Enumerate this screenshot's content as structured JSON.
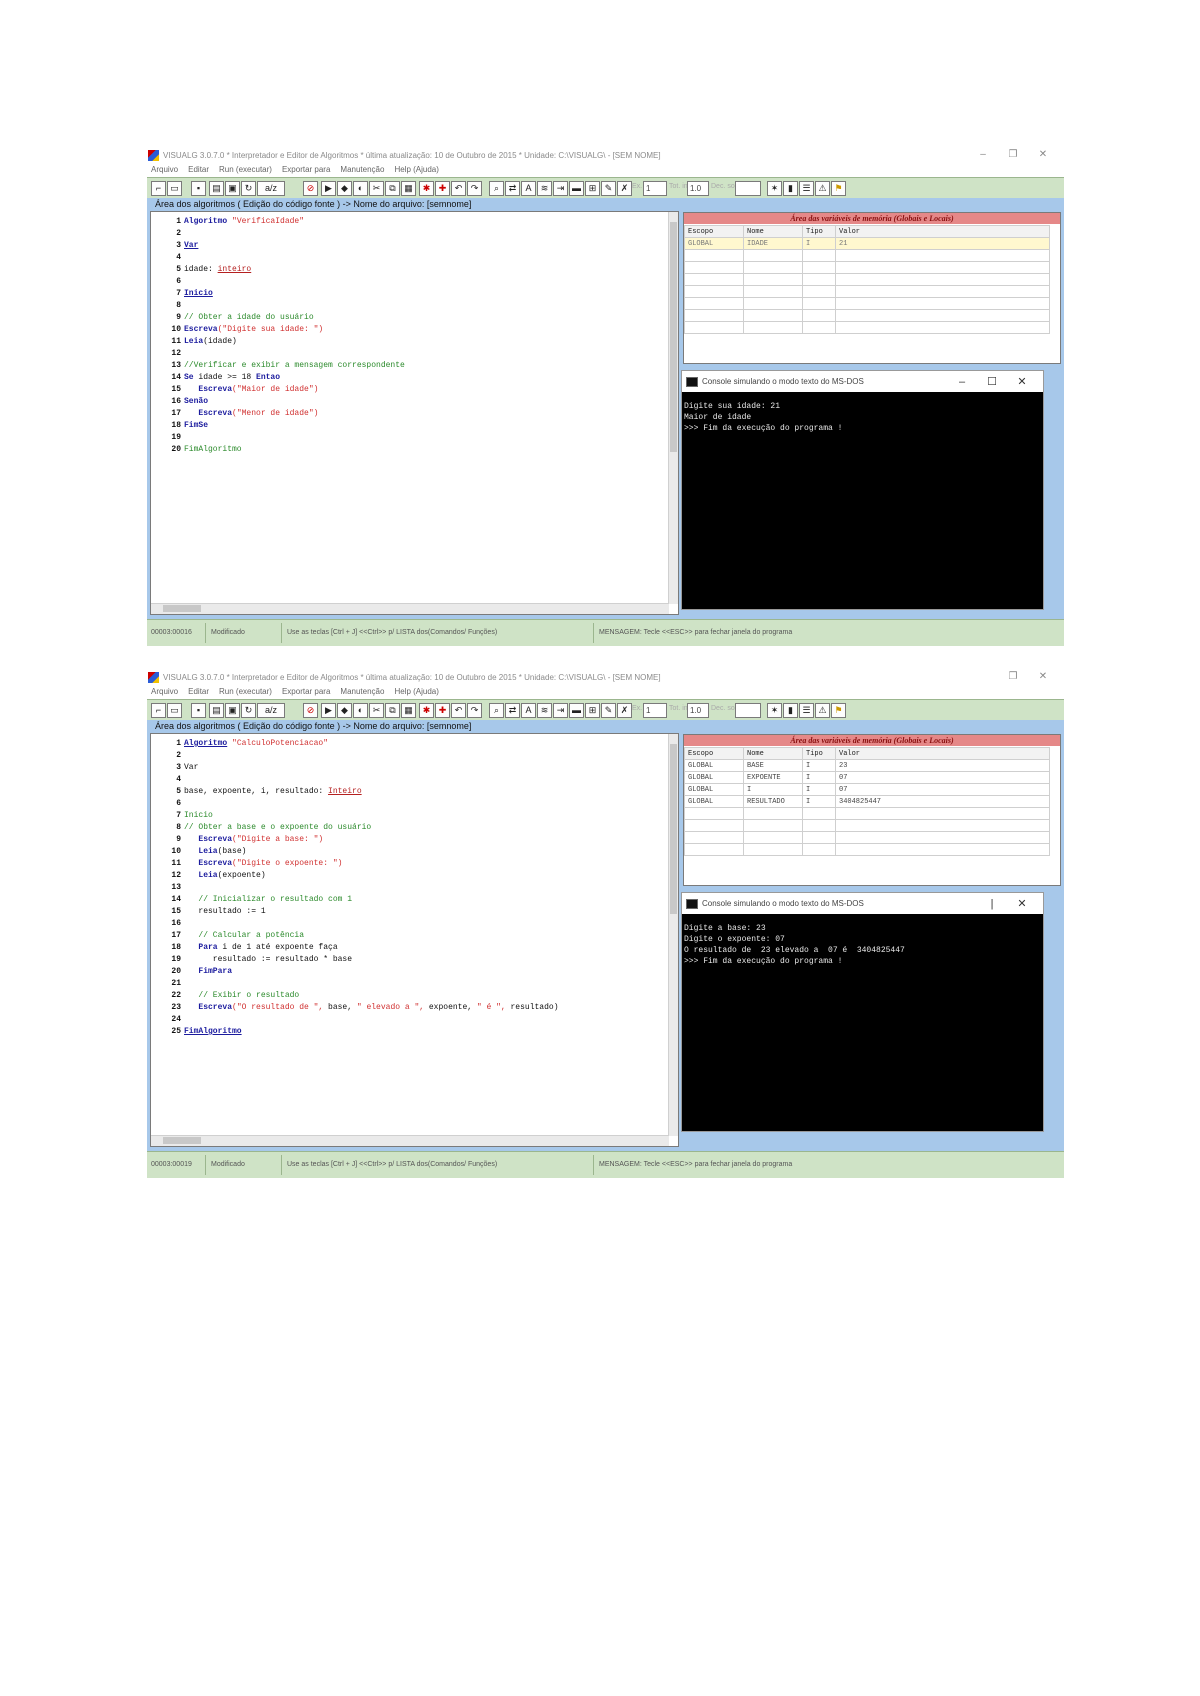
{
  "shot1": {
    "title": "VISUALG 3.0.7.0 * Interpretador e Editor de Algoritmos * última atualização: 10 de Outubro de 2015 * Unidade: C:\\VISUALG\\ - [SEM NOME]",
    "window_buttons": [
      "–",
      "❐",
      "✕"
    ],
    "menu": [
      "Arquivo",
      "Editar",
      "Run (executar)",
      "Exportar para",
      "Manutenção",
      "Help (Ajuda)"
    ],
    "toolbar_inputs": [
      "1",
      "1.0",
      ""
    ],
    "toolbar_labels": [
      "Ex.",
      "Tot. ini",
      "Dec. sor"
    ],
    "area_title": "Área dos algoritmos ( Edição do código fonte ) -> Nome do arquivo: [semnome]",
    "code": [
      {
        "n": "1",
        "segs": [
          {
            "c": "kw",
            "t": "Algoritmo "
          },
          {
            "c": "str",
            "t": "\"VerificaIdade\""
          }
        ]
      },
      {
        "n": "2",
        "segs": []
      },
      {
        "n": "3",
        "segs": [
          {
            "c": "kwu",
            "t": "Var"
          }
        ]
      },
      {
        "n": "4",
        "segs": []
      },
      {
        "n": "5",
        "segs": [
          {
            "c": "var",
            "t": "idade: "
          },
          {
            "c": "type",
            "t": "inteiro"
          }
        ]
      },
      {
        "n": "6",
        "segs": []
      },
      {
        "n": "7",
        "segs": [
          {
            "c": "kwu",
            "t": "Inicio"
          }
        ]
      },
      {
        "n": "8",
        "segs": []
      },
      {
        "n": "9",
        "segs": [
          {
            "c": "com",
            "t": "// Obter a idade do usuário"
          }
        ]
      },
      {
        "n": "10",
        "segs": [
          {
            "c": "kw",
            "t": "Escreva"
          },
          {
            "c": "str",
            "t": "(\"Digite sua idade: \")"
          }
        ]
      },
      {
        "n": "11",
        "segs": [
          {
            "c": "kw",
            "t": "Leia"
          },
          {
            "c": "var",
            "t": "(idade)"
          }
        ]
      },
      {
        "n": "12",
        "segs": []
      },
      {
        "n": "13",
        "segs": [
          {
            "c": "com",
            "t": "//Verificar e exibir a mensagem correspondente"
          }
        ]
      },
      {
        "n": "14",
        "segs": [
          {
            "c": "kw",
            "t": "Se "
          },
          {
            "c": "var",
            "t": "idade >= 18 "
          },
          {
            "c": "kw",
            "t": "Entao"
          }
        ]
      },
      {
        "n": "15",
        "segs": [
          {
            "c": "kw",
            "t": "   Escreva"
          },
          {
            "c": "str",
            "t": "(\"Maior de idade\")"
          }
        ]
      },
      {
        "n": "16",
        "segs": [
          {
            "c": "kw",
            "t": "Senão"
          }
        ]
      },
      {
        "n": "17",
        "segs": [
          {
            "c": "kw",
            "t": "   Escreva"
          },
          {
            "c": "str",
            "t": "(\"Menor de idade\")"
          }
        ]
      },
      {
        "n": "18",
        "segs": [
          {
            "c": "kw",
            "t": "FimSe"
          }
        ]
      },
      {
        "n": "19",
        "segs": []
      },
      {
        "n": "20",
        "segs": [
          {
            "c": "com",
            "t": "FimAlgoritmo"
          }
        ]
      }
    ],
    "vars_title": "Área das variáveis de memória (Globais e Locais)",
    "vars_headers": [
      "Escopo",
      "Nome",
      "Tipo",
      "Valor"
    ],
    "vars_rows": [
      [
        "GLOBAL",
        "IDADE",
        "I",
        "21"
      ]
    ],
    "console_title": "Console simulando o modo texto do MS-DOS",
    "console_buttons": [
      "–",
      "☐",
      "✕"
    ],
    "console_lines": [
      "Digite sua idade: 21",
      "Maior de idade",
      ">>> Fim da execução do programa !"
    ],
    "status": [
      "00003:00016",
      "Modificado",
      "Use as teclas [Ctrl + J] <<Ctrl>> p/ LISTA dos(Comandos/ Funções)",
      "MENSAGEM: Tecle <<ESC>> para fechar janela do programa"
    ]
  },
  "shot2": {
    "title": "VISUALG 3.0.7.0 * Interpretador e Editor de Algoritmos * última atualização: 10 de Outubro de 2015 * Unidade: C:\\VISUALG\\ - [SEM NOME]",
    "window_buttons": [
      "❐",
      "✕"
    ],
    "menu": [
      "Arquivo",
      "Editar",
      "Run (executar)",
      "Exportar para",
      "Manutenção",
      "Help (Ajuda)"
    ],
    "toolbar_inputs": [
      "1",
      "1.0",
      ""
    ],
    "toolbar_labels": [
      "Ex.",
      "Tot. ini",
      "Dec. sor"
    ],
    "area_title": "Área dos algoritmos ( Edição do código fonte ) -> Nome do arquivo: [semnome]",
    "code": [
      {
        "n": "1",
        "segs": [
          {
            "c": "kwu",
            "t": "Algoritmo"
          },
          {
            "c": "str",
            "t": " \"CalculoPotenciacao\""
          }
        ]
      },
      {
        "n": "2",
        "segs": []
      },
      {
        "n": "3",
        "segs": [
          {
            "c": "var",
            "t": "Var"
          }
        ]
      },
      {
        "n": "4",
        "segs": []
      },
      {
        "n": "5",
        "segs": [
          {
            "c": "var",
            "t": "base, expoente, i, resultado: "
          },
          {
            "c": "type",
            "t": "Inteiro"
          }
        ]
      },
      {
        "n": "6",
        "segs": []
      },
      {
        "n": "7",
        "segs": [
          {
            "c": "com",
            "t": "Inicio"
          }
        ]
      },
      {
        "n": "8",
        "segs": [
          {
            "c": "com",
            "t": "// Obter a base e o expoente do usuário"
          }
        ]
      },
      {
        "n": "9",
        "segs": [
          {
            "c": "kw",
            "t": "   Escreva"
          },
          {
            "c": "str",
            "t": "(\"Digite a base: \")"
          }
        ]
      },
      {
        "n": "10",
        "segs": [
          {
            "c": "kw",
            "t": "   Leia"
          },
          {
            "c": "var",
            "t": "(base)"
          }
        ]
      },
      {
        "n": "11",
        "segs": [
          {
            "c": "kw",
            "t": "   Escreva"
          },
          {
            "c": "str",
            "t": "(\"Digite o expoente: \")"
          }
        ]
      },
      {
        "n": "12",
        "segs": [
          {
            "c": "kw",
            "t": "   Leia"
          },
          {
            "c": "var",
            "t": "(expoente)"
          }
        ]
      },
      {
        "n": "13",
        "segs": []
      },
      {
        "n": "14",
        "segs": [
          {
            "c": "com",
            "t": "   // Inicializar o resultado com 1"
          }
        ]
      },
      {
        "n": "15",
        "segs": [
          {
            "c": "var",
            "t": "   resultado := 1"
          }
        ]
      },
      {
        "n": "16",
        "segs": []
      },
      {
        "n": "17",
        "segs": [
          {
            "c": "com",
            "t": "   // Calcular a potência"
          }
        ]
      },
      {
        "n": "18",
        "segs": [
          {
            "c": "kw",
            "t": "   Para "
          },
          {
            "c": "var",
            "t": "i de 1 até expoente faça"
          }
        ]
      },
      {
        "n": "19",
        "segs": [
          {
            "c": "var",
            "t": "      resultado := resultado * base"
          }
        ]
      },
      {
        "n": "20",
        "segs": [
          {
            "c": "kw",
            "t": "   FimPara"
          }
        ]
      },
      {
        "n": "21",
        "segs": []
      },
      {
        "n": "22",
        "segs": [
          {
            "c": "com",
            "t": "   // Exibir o resultado"
          }
        ]
      },
      {
        "n": "23",
        "segs": [
          {
            "c": "kw",
            "t": "   Escreva"
          },
          {
            "c": "str",
            "t": "(\"O resultado de \", "
          },
          {
            "c": "var",
            "t": "base, "
          },
          {
            "c": "str",
            "t": "\" elevado a \", "
          },
          {
            "c": "var",
            "t": "expoente, "
          },
          {
            "c": "str",
            "t": "\" é \", "
          },
          {
            "c": "var",
            "t": "resultado)"
          }
        ]
      },
      {
        "n": "24",
        "segs": []
      },
      {
        "n": "25",
        "segs": [
          {
            "c": "kwu",
            "t": "FimAlgoritmo"
          }
        ]
      }
    ],
    "vars_title": "Área das variáveis de memória (Globais e Locais)",
    "vars_headers": [
      "Escopo",
      "Nome",
      "Tipo",
      "Valor"
    ],
    "vars_rows": [
      [
        "GLOBAL",
        "BASE",
        "I",
        "23"
      ],
      [
        "GLOBAL",
        "EXPOENTE",
        "I",
        "07"
      ],
      [
        "GLOBAL",
        "I",
        "I",
        "07"
      ],
      [
        "GLOBAL",
        "RESULTADO",
        "I",
        "3404825447"
      ]
    ],
    "console_title": "Console simulando o modo texto do MS-DOS",
    "console_buttons": [
      "|",
      "✕"
    ],
    "console_lines": [
      "Digite a base: 23",
      "Digite o expoente: 07",
      "O resultado de  23 elevado a  07 é  3404825447",
      ">>> Fim da execução do programa !"
    ],
    "status": [
      "00003:00019",
      "Modificado",
      "Use as teclas [Ctrl + J] <<Ctrl>> p/ LISTA dos(Comandos/ Funções)",
      "MENSAGEM: Tecle <<ESC>> para fechar janela do programa"
    ]
  }
}
